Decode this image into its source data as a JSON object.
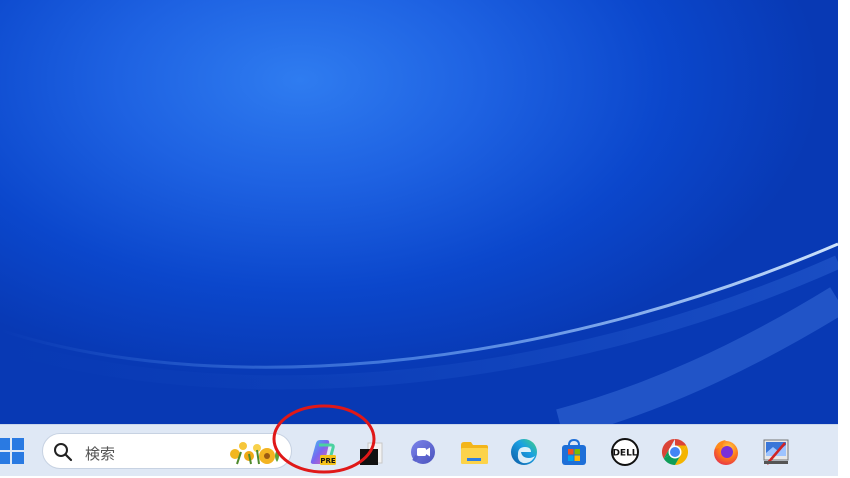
{
  "taskbar": {
    "search": {
      "placeholder": "検索"
    },
    "icons": [
      {
        "name": "start-icon"
      },
      {
        "name": "copilot-preview-icon",
        "badge": "PRE"
      },
      {
        "name": "black-app-icon"
      },
      {
        "name": "teams-icon"
      },
      {
        "name": "file-explorer-icon"
      },
      {
        "name": "edge-icon"
      },
      {
        "name": "microsoft-store-icon"
      },
      {
        "name": "dell-icon",
        "label": "DELL"
      },
      {
        "name": "chrome-icon"
      },
      {
        "name": "firefox-icon"
      },
      {
        "name": "snipping-tool-icon"
      }
    ]
  },
  "colors": {
    "wallpaper": "#0b47cc",
    "taskbar": "#dfe8f5",
    "annotation": "#e01818"
  }
}
